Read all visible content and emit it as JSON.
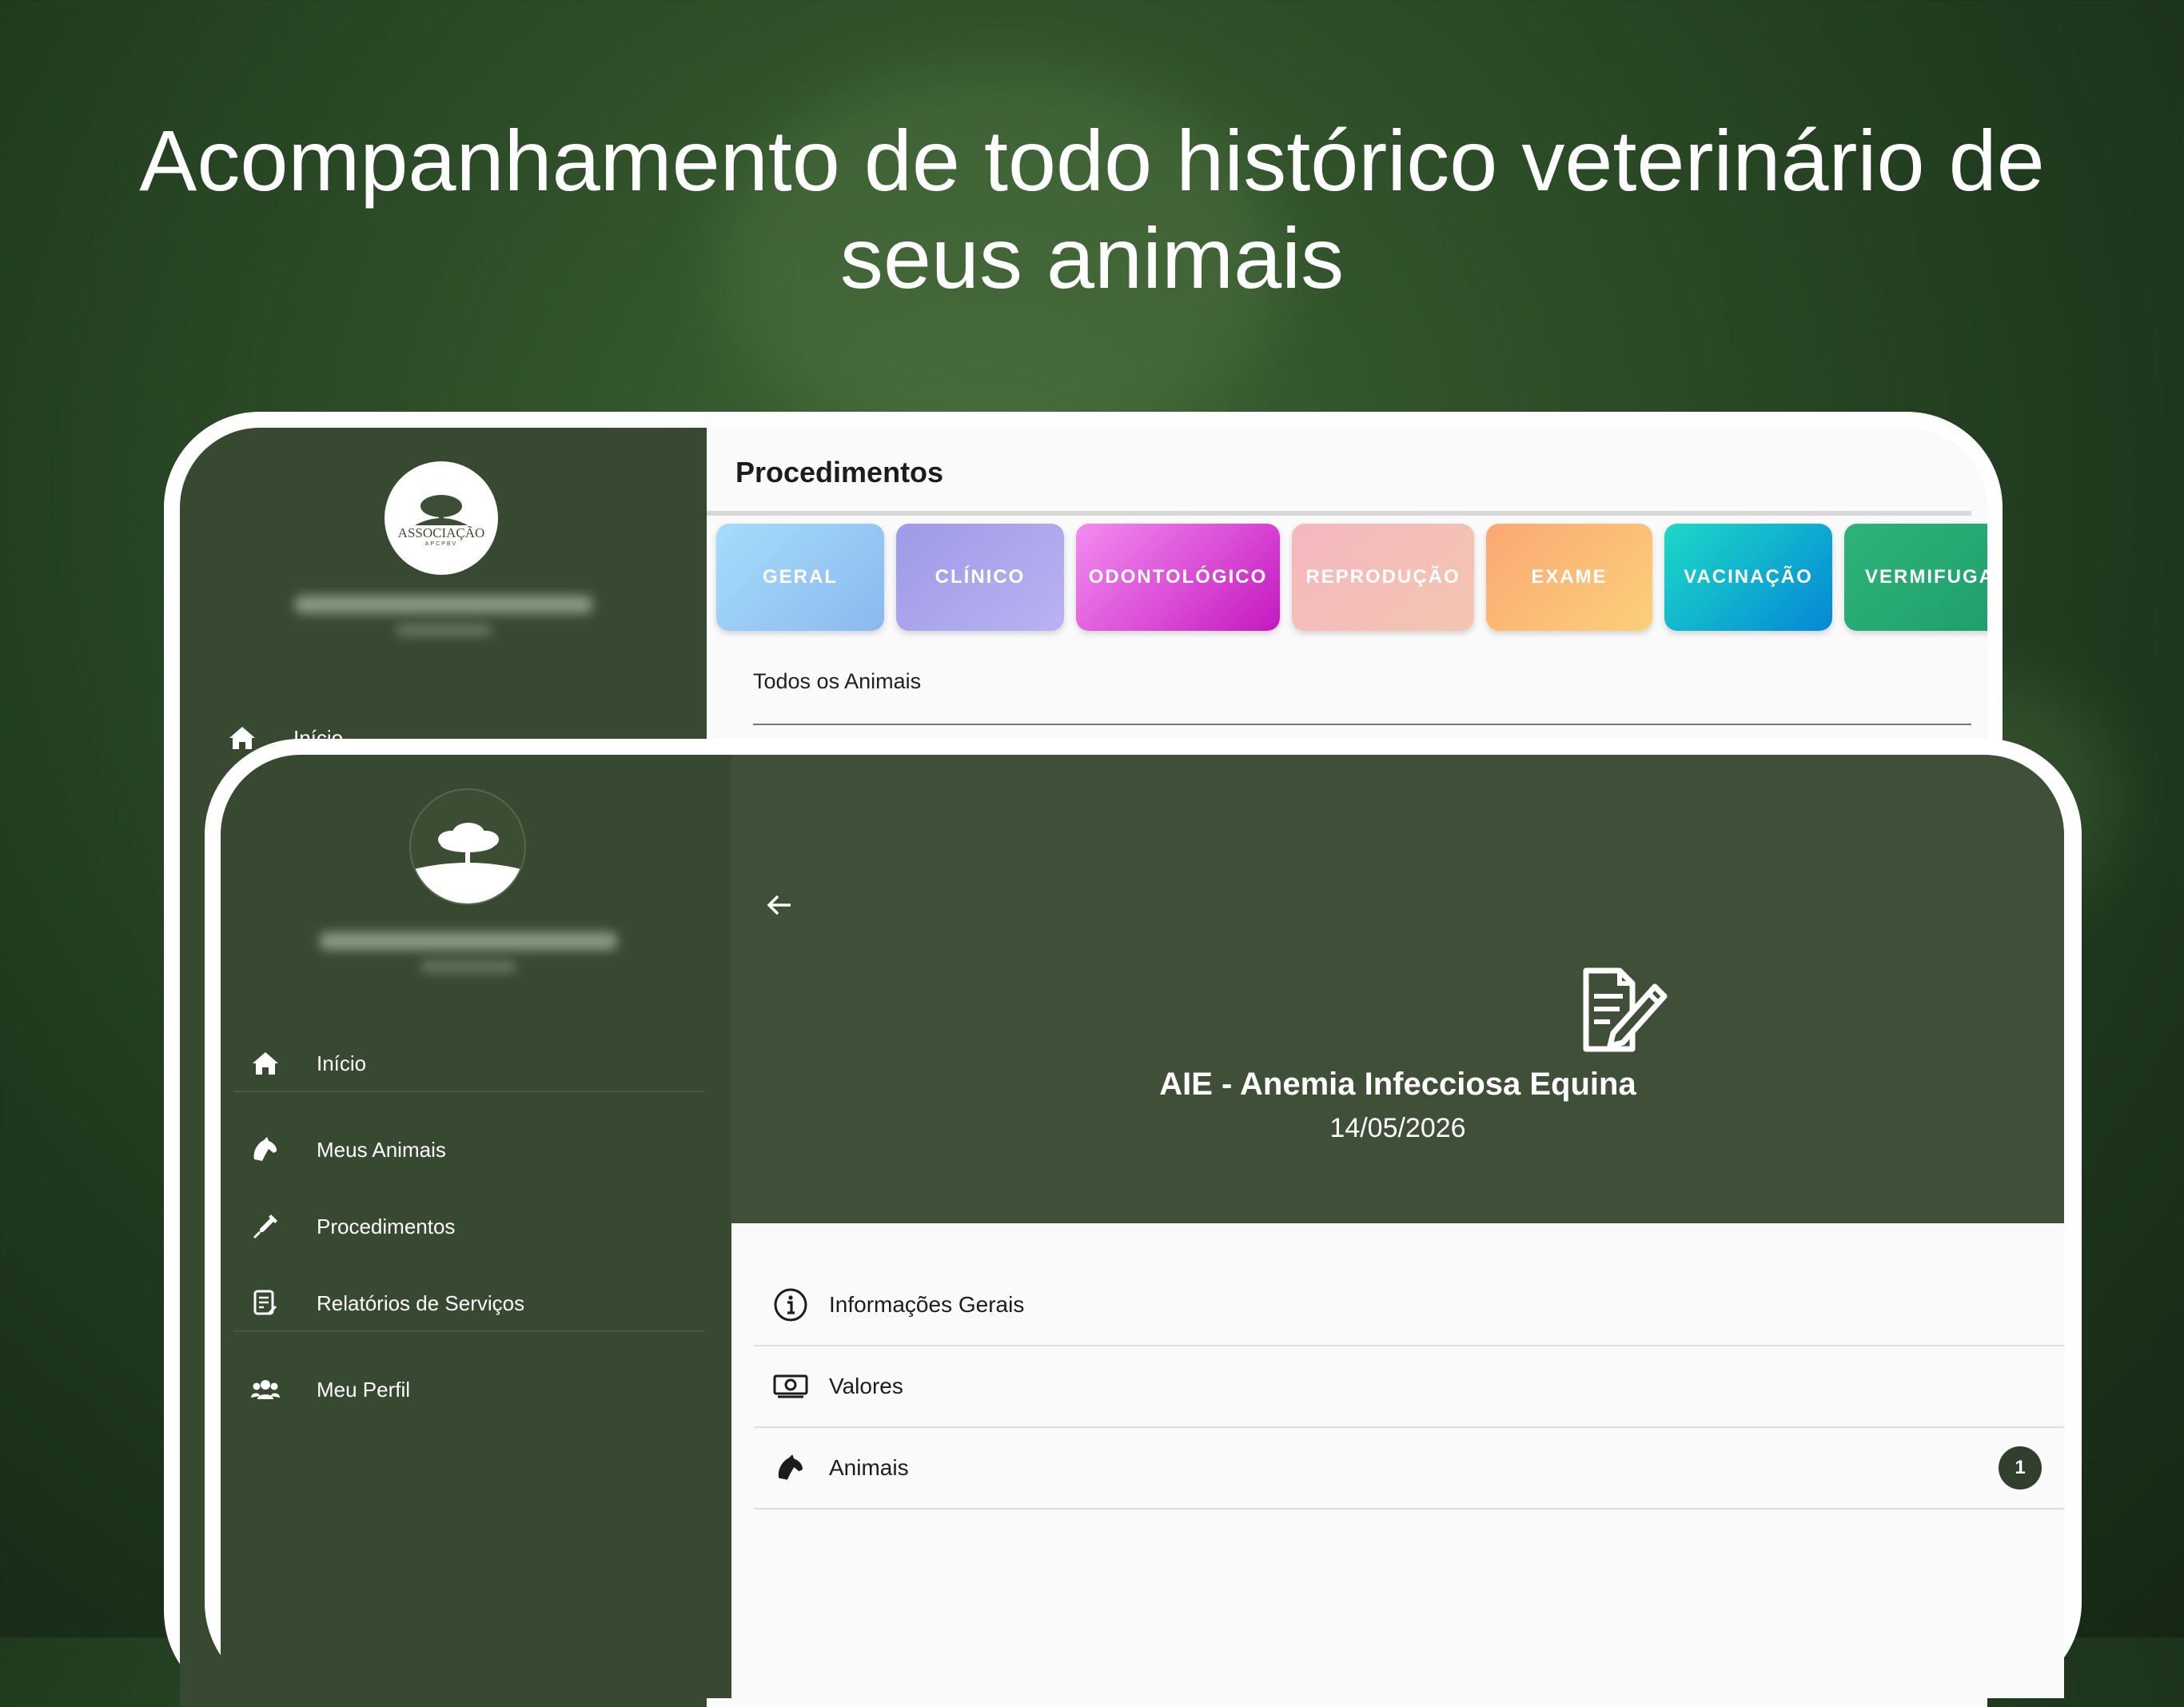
{
  "headline": {
    "line1": "Acompanhamento de todo histórico veterinário de",
    "line2": "seus animais"
  },
  "back_screen": {
    "logo_text": "ASSOCIAÇÃO",
    "logo_subtext": "APCPBV",
    "nav": [
      {
        "label": "Início",
        "icon": "home-icon"
      }
    ],
    "title": "Procedimentos",
    "categories": [
      {
        "label": "GERAL",
        "color_start": "#a6dcfb",
        "color_end": "#8bb9ef"
      },
      {
        "label": "CLÍNICO",
        "color_start": "#9f9ae8",
        "color_end": "#b9b2f2"
      },
      {
        "label": "ODONTOLÓGICO",
        "color_start": "#f38cf0",
        "color_end": "#c518c0"
      },
      {
        "label": "REPRODUÇÃO",
        "color_start": "#f4b7c0",
        "color_end": "#f4c6b0"
      },
      {
        "label": "EXAME",
        "color_start": "#fba873",
        "color_end": "#fbd07a"
      },
      {
        "label": "VACINAÇÃO",
        "color_start": "#1cd9c7",
        "color_end": "#0588d6"
      },
      {
        "label": "VERMIFUGA",
        "color_start": "#2fb37a",
        "color_end": "#1e9e6a"
      }
    ],
    "filter_label": "Todos os Animais"
  },
  "front_screen": {
    "nav": [
      {
        "label": "Início",
        "icon": "home-icon"
      },
      {
        "label": "Meus Animais",
        "icon": "horse-icon"
      },
      {
        "label": "Procedimentos",
        "icon": "syringe-icon"
      },
      {
        "label": "Relatórios de Serviços",
        "icon": "report-icon"
      },
      {
        "label": "Meu Perfil",
        "icon": "users-icon"
      }
    ],
    "procedure_title": "AIE - Anemia Infecciosa Equina",
    "procedure_date": "14/05/2026",
    "list": [
      {
        "label": "Informações Gerais",
        "icon": "info-icon"
      },
      {
        "label": "Valores",
        "icon": "money-icon"
      },
      {
        "label": "Animais",
        "icon": "horse-icon",
        "badge": "1"
      }
    ]
  },
  "colors": {
    "sidebar": "#384931",
    "hero": "#404f38",
    "badge": "#333f2d"
  }
}
